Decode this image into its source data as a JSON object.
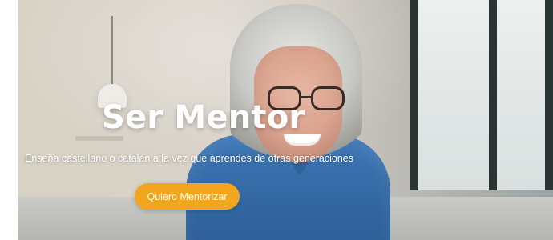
{
  "hero": {
    "title": "Ser Mentor",
    "subtitle": "Enseña castellano o catalán a la vez que aprendes de otras generaciones",
    "cta_label": "Quiero Mentorizar",
    "accent_color": "#f2a51f"
  }
}
